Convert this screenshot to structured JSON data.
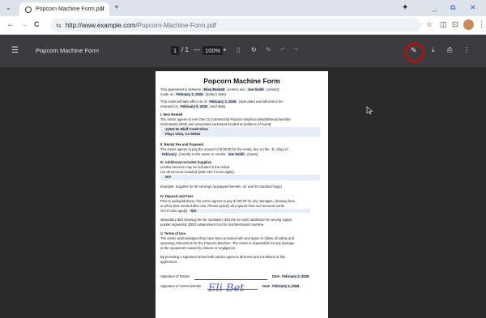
{
  "browser": {
    "tab_title": "Popcorn Machine Form.pdf",
    "tab_close": "×",
    "new_tab": "+",
    "url_host": "http://www.example.com",
    "url_path": "/Popcorn-Machine-Form.pdf",
    "back": "←",
    "forward": "→",
    "reload": "C",
    "minimize": "_",
    "maximize": "⧉",
    "close": "✕"
  },
  "pdf_toolbar": {
    "menu_icon": "☰",
    "title": "Popcorn Machine Form",
    "page_current": "1",
    "page_total": "/ 1",
    "zoom_out": "—",
    "zoom_value": "100%",
    "zoom_in": "+",
    "download_icon": "⤓",
    "print_icon": "⎙",
    "more_icon": "⋮",
    "annotate_icon": "✎"
  },
  "form": {
    "title": "Popcorn Machine Form",
    "p1_a": "This agreement is between",
    "renter": "Elisa Beckett",
    "p1_b": "(renter) and",
    "vendor": "Joe Smith",
    "p1_c": "(vendor)",
    "p1_d": "made on",
    "made_on": "February 2, 2026",
    "p1_e": "(today's date).",
    "p2_a": "This rental will take effect as of",
    "start_date": "February 2, 2026",
    "p2_b": "(start date) and will end or be",
    "p2_c": "renewed on",
    "end_date": "February 6, 2026",
    "p2_d": "(end date).",
    "s1_title": "I. Item Rented",
    "s1_l1": "The renter agrees to rent One (1) Commercial Popcorn Machine (Model/Serial Number:",
    "s1_l2": "Gold Medal 2003) and associated cart/stand located at (address of event):",
    "addr1": "12422 W. Bluff Creek Drive",
    "addr2": "Playa Vista, CA 90094",
    "s2_title": "II. Rental Fee and Payment",
    "s2_l1": "The renter agrees to pay the amount of $ 95.00 for the rental, due on the",
    "day": "2",
    "s2_l1b": "(day) of",
    "month": "February",
    "s2_l2": "(month) to the owner or vendor",
    "payee": "Joe Smith",
    "s2_l2b": "(name).",
    "s3_title": "III. Additional Included Supplies",
    "s3_l1": "Limited services may be included in the rental.",
    "s3_l2": "List all services included (write N/A if none apply):",
    "services": "N/A",
    "s3_ex": "Example: Supplies for 50 servings (unpopped kernels, oil, and 50 standard bags)",
    "s4_title": "IV. Deposit and Fees",
    "s4_l1": "Prior to pickup/delivery, the renter agrees to pay $ 100.00 for any damages, cleaning fees,",
    "s4_l2": "or other fees needed after use. Please specify all required fees and amounts (write",
    "s4_l3": "N/A if none apply):",
    "fees": "N/A",
    "s4_ex1": "Mandatory $20 cleaning fee for sanitation; $15 fee for each additional 50-serving supply",
    "s4_ex2": "packet requested; $300 replacement cost for lost/destroyed machine.",
    "s5_title": "V. Terms of Use",
    "s5_l1": "The renter acknowledges they have been provided with and agree to follow all safety and",
    "s5_l2": "operating instructions for the Popcorn Machine. The renter is responsible for any damage",
    "s5_l3": "to the equipment caused by misuse or negligence.",
    "agree_l1": "By providing a signature below both parties agree to all terms and conditions of this",
    "agree_l2": "agreement.",
    "sig_renter_label": "Signature of Renter",
    "sig_renter": "Eli Bet",
    "date_label": "Date",
    "renter_date": "February 2, 2026",
    "sig_owner_label": "Signature of Owner/Vendor",
    "owner_date": "February 2, 2026"
  }
}
